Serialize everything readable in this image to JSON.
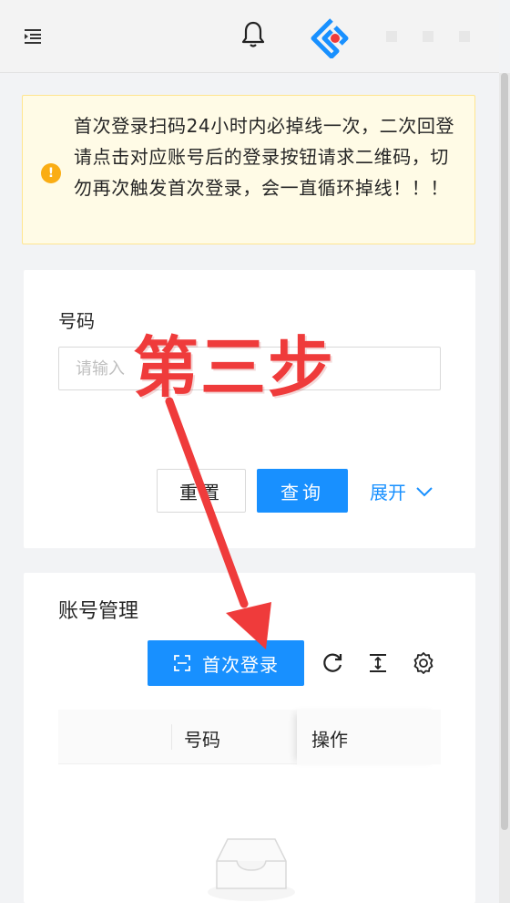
{
  "colors": {
    "primary": "#1890ff",
    "alert_bg": "#fffbe6",
    "alert_border": "#ffe58f",
    "warning": "#faad14",
    "annotation": "#ef3b3b"
  },
  "header": {
    "icons": [
      "menu-fold-icon",
      "bell-icon",
      "app-logo-icon"
    ]
  },
  "alert": {
    "icon": "exclamation-circle-icon",
    "message": "首次登录扫码24小时内必掉线一次，二次回登请点击对应账号后的登录按钮请求二维码，切勿再次触发首次登录，会一直循环掉线！！！"
  },
  "search": {
    "label": "号码",
    "placeholder": "请输入",
    "reset_label": "重置",
    "query_label": "查询",
    "expand_label": "展开"
  },
  "account": {
    "title": "账号管理",
    "first_login_label": "首次登录",
    "toolbar_icons": [
      "reload-icon",
      "column-height-icon",
      "setting-icon"
    ],
    "columns": [
      "号码",
      "操作"
    ]
  },
  "annotation": {
    "text": "第三步"
  }
}
